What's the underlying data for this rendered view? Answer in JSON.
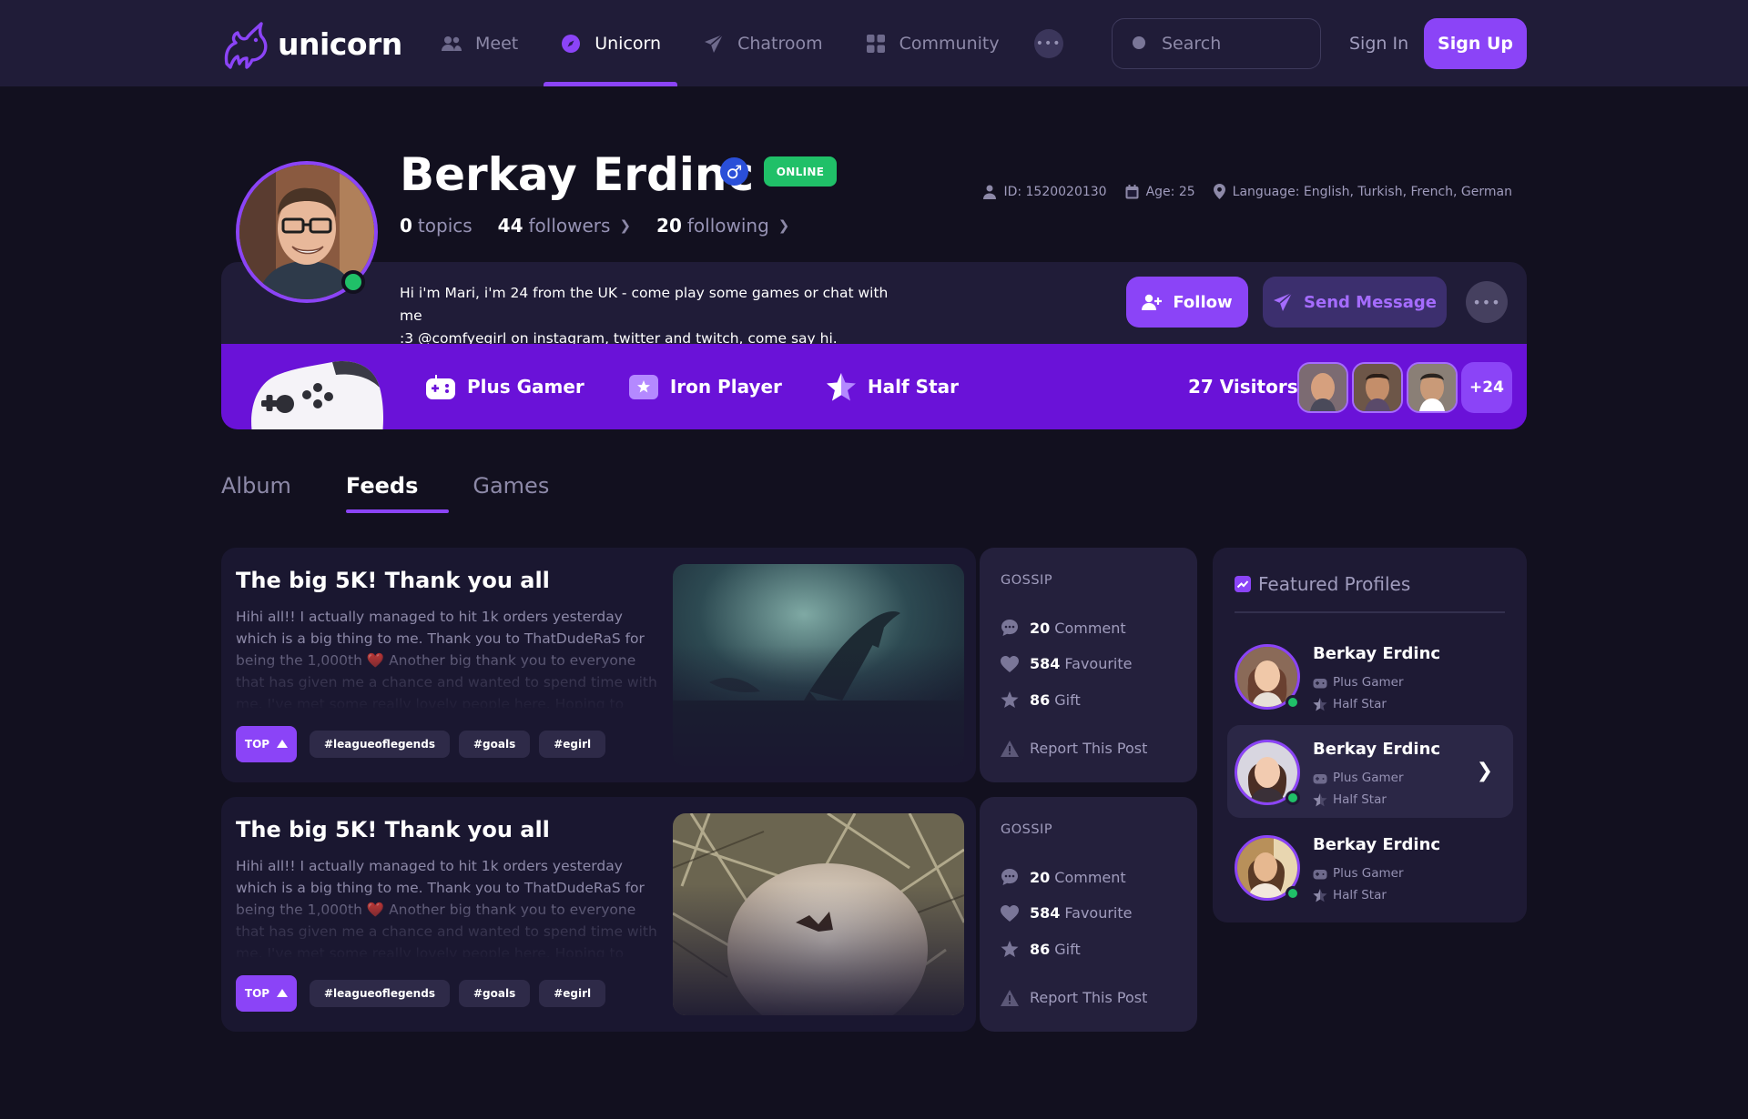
{
  "nav": {
    "logo_text": "unicorn",
    "items": [
      {
        "label": "Meet",
        "icon": "people-icon"
      },
      {
        "label": "Unicorn",
        "icon": "compass-icon"
      },
      {
        "label": "Chatroom",
        "icon": "paper-plane-icon"
      },
      {
        "label": "Community",
        "icon": "grid-icon"
      }
    ],
    "active_index": 1,
    "search_placeholder": "Search",
    "sign_in": "Sign In",
    "sign_up": "Sign Up"
  },
  "profile": {
    "name": "Berkay Erdinc",
    "gender_symbol": "♂",
    "status": "ONLINE",
    "topics_count": "0",
    "topics_label": "topics",
    "followers_count": "44",
    "followers_label": "followers",
    "following_count": "20",
    "following_label": "following",
    "id": "ID: 1520020130",
    "age": "Age: 25",
    "language": "Language: English, Turkish, French, German",
    "bio_line1": "Hi i'm Mari, i'm 24 from the UK - come play some games or chat with me",
    "bio_line2": ":3 @comfyegirl on instagram, twitter and twitch, come say hi.",
    "follow_label": "Follow",
    "message_label": "Send Message"
  },
  "badges": {
    "items": [
      {
        "label": "Plus Gamer",
        "icon": "gamepad-icon"
      },
      {
        "label": "Iron Player",
        "icon": "star-box-icon"
      },
      {
        "label": "Half Star",
        "icon": "half-star-icon"
      }
    ],
    "visitors_label": "27 Visitors",
    "more_visitors": "+24"
  },
  "tabs": [
    {
      "label": "Album"
    },
    {
      "label": "Feeds"
    },
    {
      "label": "Games"
    }
  ],
  "active_tab": 1,
  "feeds": [
    {
      "title": "The big 5K! Thank you all",
      "text": "Hihi all!! I actually managed to hit 1k orders yesterday which is a big thing to me. Thank you to ThatDudeRaS for being the 1,000th ❤️ Another big thank you to everyone that has given me a chance and wanted to spend time with me. I've met some really lovely people here. Hoping to meet more new",
      "top_label": "TOP",
      "tags": [
        "#leagueoflegends",
        "#goals",
        "#egirl"
      ],
      "category": "GOSSIP",
      "comments": "20",
      "comments_label": "Comment",
      "favourites": "584",
      "favourites_label": "Favourite",
      "gifts": "86",
      "gifts_label": "Gift",
      "report_label": "Report This Post",
      "image": "shark-underwater"
    },
    {
      "title": "The big 5K! Thank you all",
      "text": "Hihi all!! I actually managed to hit 1k orders yesterday which is a big thing to me. Thank you to ThatDudeRaS for being the 1,000th ❤️ Another big thank you to everyone that has given me a chance and wanted to spend time with me. I've met some really lovely people here. Hoping to meet more new",
      "top_label": "TOP",
      "tags": [
        "#leagueoflegends",
        "#goals",
        "#egirl"
      ],
      "category": "GOSSIP",
      "comments": "20",
      "comments_label": "Comment",
      "favourites": "584",
      "favourites_label": "Favourite",
      "gifts": "86",
      "gifts_label": "Gift",
      "report_label": "Report This Post",
      "image": "hatching-egg"
    }
  ],
  "featured": {
    "title": "Featured Profiles",
    "profiles": [
      {
        "name": "Berkay Erdinc",
        "badge1": "Plus Gamer",
        "badge2": "Half Star"
      },
      {
        "name": "Berkay Erdinc",
        "badge1": "Plus Gamer",
        "badge2": "Half Star"
      },
      {
        "name": "Berkay Erdinc",
        "badge1": "Plus Gamer",
        "badge2": "Half Star"
      }
    ],
    "active_index": 1
  },
  "colors": {
    "accent": "#8b44f7",
    "badge_bar": "#6a12d8",
    "online": "#20c068",
    "background": "#12101f"
  }
}
